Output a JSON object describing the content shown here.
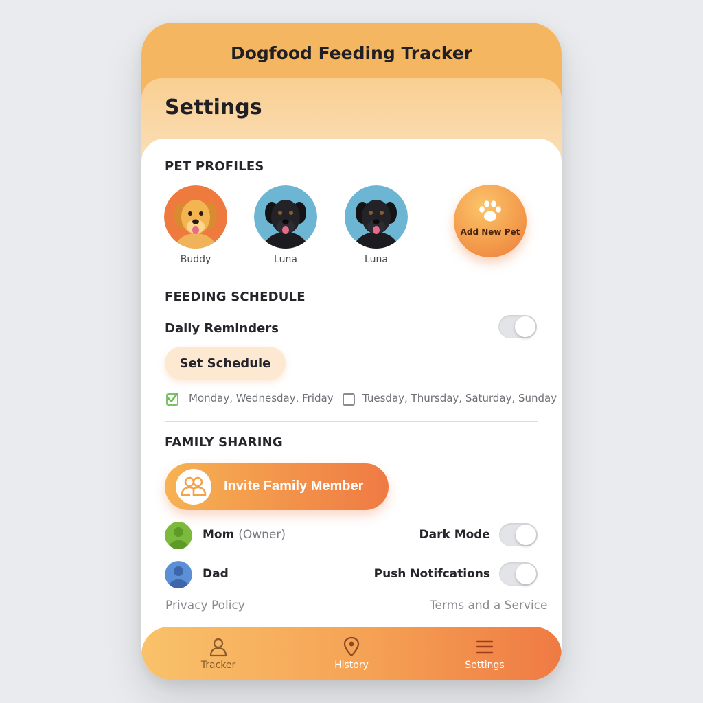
{
  "app": {
    "title": "Dogfood Feeding Tracker"
  },
  "page": {
    "title": "Settings"
  },
  "pet_profiles": {
    "heading": "PET PROFILES",
    "pets": [
      {
        "name": "Buddy",
        "avatar_icon": "golden-retriever-icon",
        "bg_color": "#ee7a3e"
      },
      {
        "name": "Luna",
        "avatar_icon": "black-lab-icon",
        "bg_color": "#6cb6d3"
      },
      {
        "name": "Luna",
        "avatar_icon": "black-lab-icon",
        "bg_color": "#6cb6d3"
      }
    ],
    "add_label": "Add New Pet",
    "add_icon": "paw-icon"
  },
  "feeding_schedule": {
    "heading": "FEEDING SCHEDULE",
    "daily_reminders_label": "Daily Reminders",
    "daily_reminders_on": false,
    "set_schedule_label": "Set Schedule",
    "day_options": [
      {
        "label": "Monday, Wednesday, Friday",
        "checked": true
      },
      {
        "label": "Tuesday, Thursday, Saturday, Sunday",
        "checked": false
      }
    ]
  },
  "family_sharing": {
    "heading": "FAMILY SHARING",
    "invite_label": "Invite Family Member",
    "invite_icon": "people-icon",
    "members": [
      {
        "name": "Mom",
        "role": "(Owner)",
        "avatar_color": "#7cba3c"
      },
      {
        "name": "Dad",
        "role": "",
        "avatar_color": "#5b8fd6"
      }
    ]
  },
  "preferences": {
    "dark_mode_label": "Dark Mode",
    "dark_mode_on": false,
    "push_label": "Push Notifcations",
    "push_on": false
  },
  "footer": {
    "privacy_label": "Privacy Policy",
    "terms_label": "Terms and a Service"
  },
  "bottom_nav": {
    "items": [
      {
        "label": "Tracker",
        "icon": "person-icon",
        "color": "#8a5a2c"
      },
      {
        "label": "History",
        "icon": "location-pin-icon",
        "color": "#ffffff"
      },
      {
        "label": "Settings",
        "icon": "menu-icon",
        "color": "#ffffff"
      }
    ],
    "active": "Settings"
  },
  "colors": {
    "accent_orange": "#ef7a44",
    "accent_yellow": "#f4b660",
    "background": "#e9ebee"
  }
}
